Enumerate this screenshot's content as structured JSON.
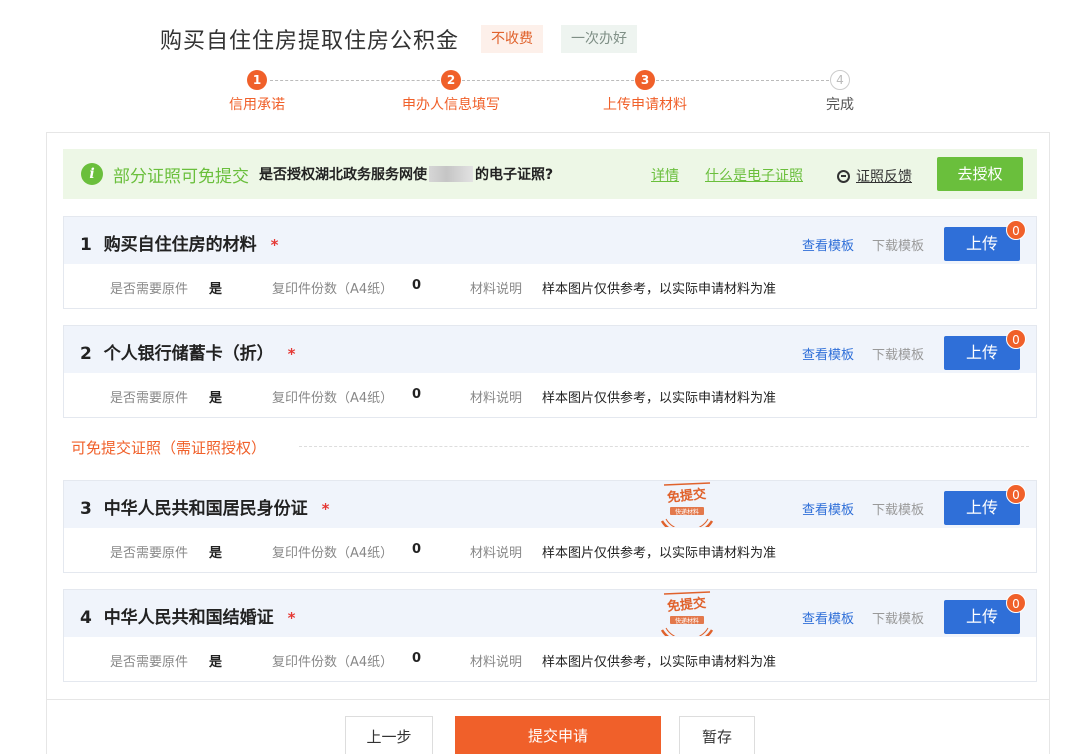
{
  "header": {
    "title": "购买自住住房提取住房公积金",
    "tags": [
      "不收费",
      "一次办好"
    ]
  },
  "steps": [
    {
      "num": "1",
      "label": "信用承诺",
      "state": "done"
    },
    {
      "num": "2",
      "label": "申办人信息填写",
      "state": "done"
    },
    {
      "num": "3",
      "label": "上传申请材料",
      "state": "current"
    },
    {
      "num": "4",
      "label": "完成",
      "state": "todo"
    }
  ],
  "notice": {
    "icon": "info-icon",
    "title": "部分证照可免提交",
    "question_prefix": "是否授权湖北政务服务网使",
    "question_suffix": "的电子证照?",
    "details_link": "详情",
    "what_link": "什么是电子证照",
    "feedback": "证照反馈",
    "authorize_button": "去授权"
  },
  "common": {
    "view_template": "查看模板",
    "download_template": "下载模板",
    "upload": "上传",
    "need_original_label": "是否需要原件",
    "copies_label": "复印件份数（A4纸）",
    "desc_label": "材料说明",
    "stamp_text": "免提交",
    "stamp_subtext": "快递材料"
  },
  "materials": [
    {
      "index": "1",
      "name": "购买自住住房的材料",
      "required": "*",
      "need_original": "是",
      "copies": "0",
      "description": "样本图片仅供参考，以实际申请材料为准",
      "upload_count": "0",
      "exempt": false
    },
    {
      "index": "2",
      "name": "个人银行储蓄卡（折）",
      "required": "*",
      "need_original": "是",
      "copies": "0",
      "description": "样本图片仅供参考，以实际申请材料为准",
      "upload_count": "0",
      "exempt": false
    },
    {
      "index": "3",
      "name": "中华人民共和国居民身份证",
      "required": "*",
      "need_original": "是",
      "copies": "0",
      "description": "样本图片仅供参考，以实际申请材料为准",
      "upload_count": "0",
      "exempt": true
    },
    {
      "index": "4",
      "name": "中华人民共和国结婚证",
      "required": "*",
      "need_original": "是",
      "copies": "0",
      "description": "样本图片仅供参考，以实际申请材料为准",
      "upload_count": "0",
      "exempt": true
    }
  ],
  "exempt_section_title": "可免提交证照（需证照授权）",
  "footer": {
    "prev": "上一步",
    "submit": "提交申请",
    "save": "暂存"
  },
  "colors": {
    "accent": "#f0602a",
    "primary": "#2f6fd8",
    "green": "#6abf3c"
  }
}
